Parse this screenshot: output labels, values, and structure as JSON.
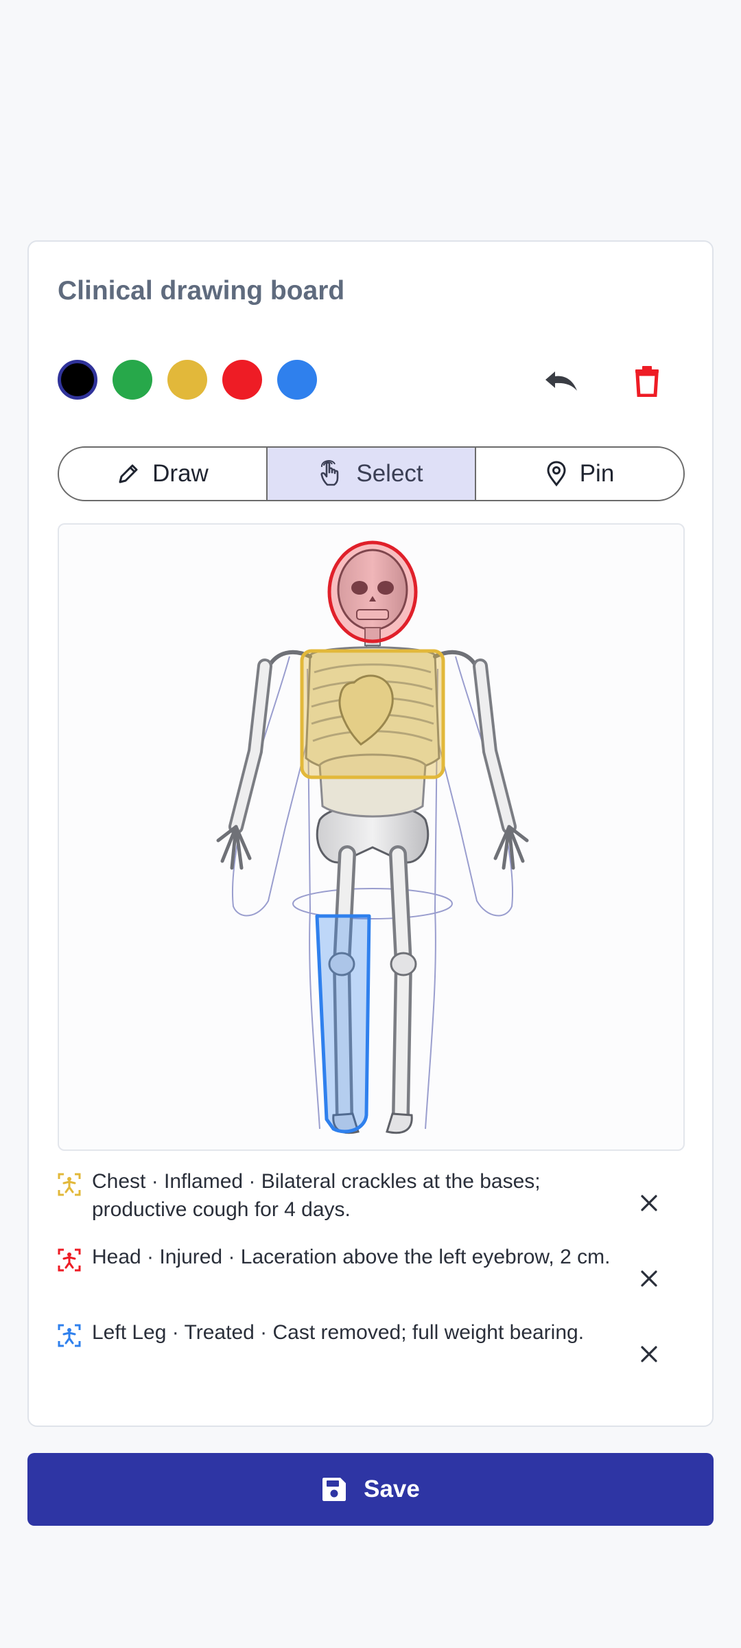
{
  "board": {
    "title": "Clinical drawing board",
    "colors": [
      {
        "name": "black",
        "hex": "#000000",
        "selected": true
      },
      {
        "name": "green",
        "hex": "#27a84a",
        "selected": false
      },
      {
        "name": "yellow",
        "hex": "#e2b83a",
        "selected": false
      },
      {
        "name": "red",
        "hex": "#ee1c25",
        "selected": false
      },
      {
        "name": "blue",
        "hex": "#2f80ed",
        "selected": false
      }
    ],
    "tools": {
      "undo_icon": "undo-icon",
      "delete_icon": "trash-icon"
    }
  },
  "modes": [
    {
      "label": "Draw",
      "icon": "pencil-icon",
      "active": false
    },
    {
      "label": "Select",
      "icon": "hand-pointer-icon",
      "active": true
    },
    {
      "label": "Pin",
      "icon": "map-pin-icon",
      "active": false
    }
  ],
  "annotations": [
    {
      "region": "Head",
      "color": "#ee1c25"
    },
    {
      "region": "Chest",
      "color": "#e2b83a"
    },
    {
      "region": "Left Leg",
      "color": "#2f80ed"
    }
  ],
  "notes": [
    {
      "text": "Chest · Inflamed · Bilateral crackles at the bases; productive cough for 4 days.",
      "color": "#e2b83a",
      "icon": "body-marker-icon"
    },
    {
      "text": "Head · Injured · Laceration above the left eyebrow, 2 cm.",
      "color": "#ee1c25",
      "icon": "body-marker-icon"
    },
    {
      "text": "Left Leg · Treated · Cast removed; full weight bearing.",
      "color": "#2f80ed",
      "icon": "body-marker-icon"
    }
  ],
  "save": {
    "label": "Save",
    "icon": "floppy-disk-icon"
  }
}
